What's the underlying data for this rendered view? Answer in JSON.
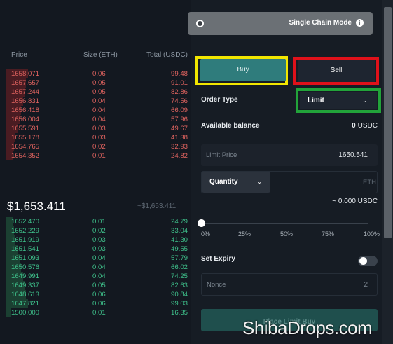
{
  "orderbook": {
    "headers": {
      "price": "Price",
      "size": "Size (ETH)",
      "total": "Total (USDC)"
    },
    "asks": [
      {
        "price": "1658.071",
        "size": "0.06",
        "total": "99.48",
        "depth": 1.0
      },
      {
        "price": "1657.657",
        "size": "0.05",
        "total": "91.01",
        "depth": 0.92
      },
      {
        "price": "1657.244",
        "size": "0.05",
        "total": "82.86",
        "depth": 0.85
      },
      {
        "price": "1656.831",
        "size": "0.04",
        "total": "74.56",
        "depth": 0.77
      },
      {
        "price": "1656.418",
        "size": "0.04",
        "total": "66.09",
        "depth": 0.69
      },
      {
        "price": "1656.004",
        "size": "0.04",
        "total": "57.96",
        "depth": 0.61
      },
      {
        "price": "1655.591",
        "size": "0.03",
        "total": "49.67",
        "depth": 0.53
      },
      {
        "price": "1655.178",
        "size": "0.03",
        "total": "41.38",
        "depth": 0.45
      },
      {
        "price": "1654.765",
        "size": "0.02",
        "total": "32.93",
        "depth": 0.37
      },
      {
        "price": "1654.352",
        "size": "0.01",
        "total": "24.82",
        "depth": 0.3
      }
    ],
    "mid_price": "$1,653.411",
    "mid_approx": "~$1,653.411",
    "bids": [
      {
        "price": "1652.470",
        "size": "0.01",
        "total": "24.79",
        "depth": 0.3
      },
      {
        "price": "1652.229",
        "size": "0.02",
        "total": "33.04",
        "depth": 0.37
      },
      {
        "price": "1651.919",
        "size": "0.03",
        "total": "41.30",
        "depth": 0.45
      },
      {
        "price": "1651.541",
        "size": "0.03",
        "total": "49.55",
        "depth": 0.53
      },
      {
        "price": "1651.093",
        "size": "0.04",
        "total": "57.79",
        "depth": 0.61
      },
      {
        "price": "1650.576",
        "size": "0.04",
        "total": "66.02",
        "depth": 0.69
      },
      {
        "price": "1649.991",
        "size": "0.04",
        "total": "74.25",
        "depth": 0.77
      },
      {
        "price": "1649.337",
        "size": "0.05",
        "total": "82.63",
        "depth": 0.85
      },
      {
        "price": "1648.613",
        "size": "0.06",
        "total": "90.84",
        "depth": 0.92
      },
      {
        "price": "1647.821",
        "size": "0.06",
        "total": "99.03",
        "depth": 1.0
      },
      {
        "price": "1500.000",
        "size": "0.01",
        "total": "16.35",
        "depth": 0.25
      }
    ]
  },
  "panel": {
    "chain_mode_label": "Single Chain Mode",
    "chain_info_icon": "info-icon",
    "buy_label": "Buy",
    "sell_label": "Sell",
    "order_type_label": "Order Type",
    "order_type_value": "Limit",
    "available_balance_label": "Available balance",
    "available_balance_value": "0",
    "available_balance_unit": "USDC",
    "limit_price_placeholder": "Limit Price",
    "limit_price_value": "1650.541",
    "quantity_select_label": "Quantity",
    "quantity_unit": "ETH",
    "approx_usdc": "~ 0.000 USDC",
    "slider_ticks": [
      "0%",
      "25%",
      "50%",
      "75%",
      "100%"
    ],
    "slider_value_percent": 0,
    "set_expiry_label": "Set Expiry",
    "set_expiry_on": false,
    "nonce_placeholder": "Nonce",
    "nonce_value": "2",
    "place_button_label": "Place Limit Buy"
  },
  "colors": {
    "ask": "#e0635f",
    "bid": "#3fc28c",
    "buy_button": "#2f7c7c",
    "highlight_buy": "#f2e600",
    "highlight_sell": "#e0111a",
    "highlight_order_type": "#22a33a"
  },
  "watermark": "ShibaDrops.com"
}
